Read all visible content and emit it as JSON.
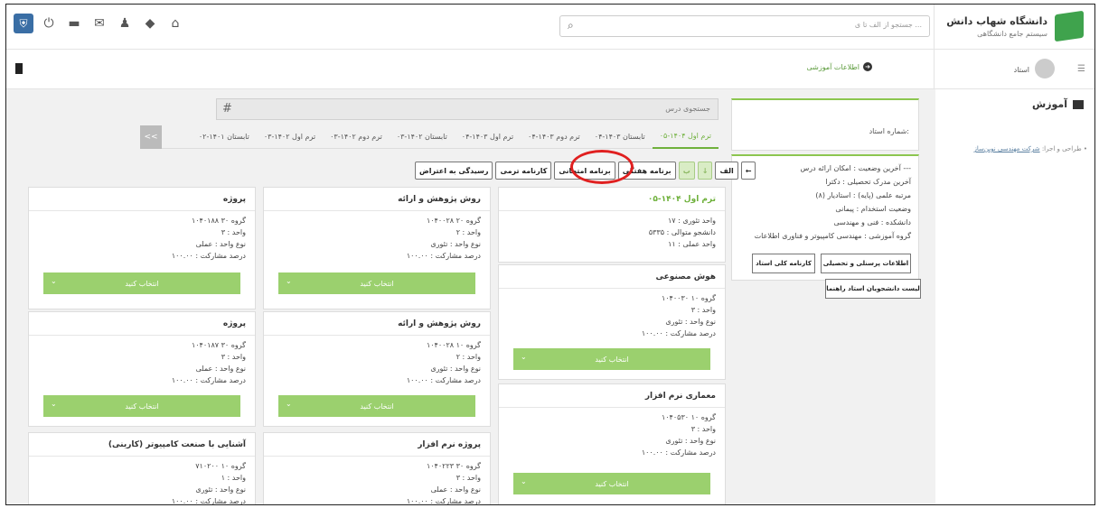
{
  "header": {
    "search_placeholder": "جستجو از الف تا ی ...",
    "university_name": "دانشگاه شهاب دانش",
    "university_subtitle": "سیستم جامع دانشگاهی",
    "icons": [
      "shield-icon",
      "power-icon",
      "folder-icon",
      "envelope-icon",
      "user-icon",
      "cube-icon",
      "home-icon"
    ]
  },
  "breadcrumb": {
    "label": "اطلاعات آموزشی"
  },
  "user": {
    "role": "استاد"
  },
  "sidebar": {
    "menu_label": "آموزش",
    "credit_prefix": "طراحی و اجرا:",
    "credit_link": "شرکت مهندسی نوین‌ساز"
  },
  "professor": {
    "number_label": "شماره استاد:",
    "details": [
      "آخرین وضعیت : امکان ارائه درس ---",
      "آخرین مدرک تحصیلی : دکترا",
      "مرتبه علمی (پایه) : استادیار (۸)",
      "وضعیت استخدام : پیمانی",
      "دانشکده : فنی و مهندسی",
      "گروه آموزشی : مهندسی کامپیوتر و فناوری اطلاعات"
    ],
    "buttons": {
      "personnel": "اطلاعات پرسنلی و تحصیلی",
      "transcript": "کارنامه کلی استاد",
      "advisees": "لیست دانشجویان استاد راهنما"
    }
  },
  "course_search": {
    "placeholder": "جستجوی درس",
    "hash": "#"
  },
  "terms": [
    "ترم اول ۱۴۰۴-۰۵",
    "تابستان ۱۴۰۳-۰۴",
    "ترم دوم ۱۴۰۳-۰۴",
    "ترم اول ۱۴۰۳-۰۴",
    "تابستان ۱۴۰۲-۰۳",
    "ترم دوم ۱۴۰۲-۰۳",
    "ترم اول ۱۴۰۲-۰۳",
    "تابستان ۱۴۰۱-۰۲"
  ],
  "terms_nav": "<<",
  "toolbar": {
    "back": "←",
    "alef": "الف",
    "down": "↓",
    "small": "ب",
    "weekly": "برنامه هفتگی",
    "exam": "برنامه امتحانی",
    "term_report": "کارنامه ترمی",
    "objection": "رسیدگی به اعتراض"
  },
  "term_card": {
    "title": "ترم اول ۱۴۰۴-۰۵",
    "lines": [
      "واحد تئوری : ۱۷",
      "دانشجو متوالی : ۵۳۳۵",
      "واحد عملی : ۱۱"
    ]
  },
  "select_label": "انتخاب کنید",
  "courses": [
    {
      "title": "هوش مصنوعی",
      "lines": [
        "۱۰۴۰۰۳۰ گروه ۱۰",
        "واحد : ۳",
        "نوع واحد : تئوری",
        "درصد مشارکت : ۱۰۰.۰۰"
      ]
    },
    {
      "title": "معماری نرم افزار",
      "lines": [
        "۱۰۴۰۵۳۰ گروه ۱۰",
        "واحد : ۳",
        "نوع واحد : تئوری",
        "درصد مشارکت : ۱۰۰.۰۰"
      ]
    },
    {
      "title": "روش پژوهش و ارائه",
      "lines": [
        "۱۰۴۰۰۲۸ گروه ۲۰",
        "واحد : ۲",
        "نوع واحد : تئوری",
        "درصد مشارکت : ۱۰۰.۰۰"
      ]
    },
    {
      "title": "روش پژوهش و ارائه",
      "lines": [
        "۱۰۴۰۰۲۸ گروه ۱۰",
        "واحد : ۲",
        "نوع واحد : تئوری",
        "درصد مشارکت : ۱۰۰.۰۰"
      ]
    },
    {
      "title": "پروژه نرم افزار",
      "lines": [
        "۱۰۴۰۲۲۳ گروه ۳۰",
        "واحد : ۳",
        "نوع واحد : عملی",
        "درصد مشارکت : ۱۰۰.۰۰"
      ]
    },
    {
      "title": "پروژه",
      "lines": [
        "۱۰۴۰۱۸۸ گروه ۳۰",
        "واحد : ۳",
        "نوع واحد : عملی",
        "درصد مشارکت : ۱۰۰.۰۰"
      ]
    },
    {
      "title": "پروژه",
      "lines": [
        "۱۰۴۰۱۸۷ گروه ۳۰",
        "واحد : ۳",
        "نوع واحد : عملی",
        "درصد مشارکت : ۱۰۰.۰۰"
      ]
    },
    {
      "title": "آشنایی با صنعت کامپیوتر (کارینی)",
      "lines": [
        "۷۱۰۲۰۰ گروه ۱۰",
        "واحد : ۱",
        "نوع واحد : تئوری",
        "درصد مشارکت : ۱۰۰.۰۰"
      ]
    }
  ],
  "colors": {
    "accent": "#6fb13c",
    "select_button": "#9bd06e",
    "highlight_circle": "#e02020"
  }
}
